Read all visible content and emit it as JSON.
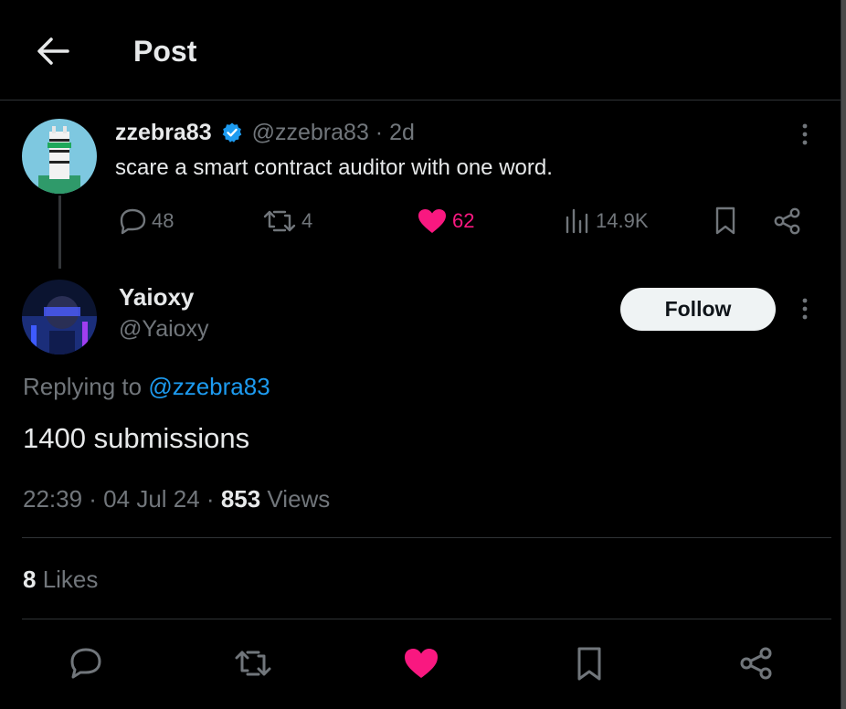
{
  "header": {
    "title": "Post"
  },
  "quoted": {
    "name": "zzebra83",
    "handle_time": "@zzebra83 · 2d",
    "text": "scare a smart contract auditor with one word.",
    "replies": "48",
    "reposts": "4",
    "likes": "62",
    "views": "14.9K"
  },
  "post": {
    "name": "Yaioxy",
    "handle": "@Yaioxy",
    "follow_label": "Follow",
    "replying_prefix": "Replying to ",
    "replying_mention": "@zzebra83",
    "text": "1400 submissions",
    "time_date": "22:39 · 04 Jul 24 · ",
    "views_count": "853",
    "views_label": " Views",
    "likes_count": "8",
    "likes_label": " Likes"
  },
  "colors": {
    "accent": "#1d9bf0",
    "like": "#f91880",
    "muted": "#71767b",
    "text": "#e7e9ea"
  },
  "icons": [
    "back-arrow-icon",
    "verified-badge-icon",
    "more-icon",
    "reply-icon",
    "repost-icon",
    "heart-icon",
    "views-icon",
    "bookmark-icon",
    "share-icon"
  ]
}
